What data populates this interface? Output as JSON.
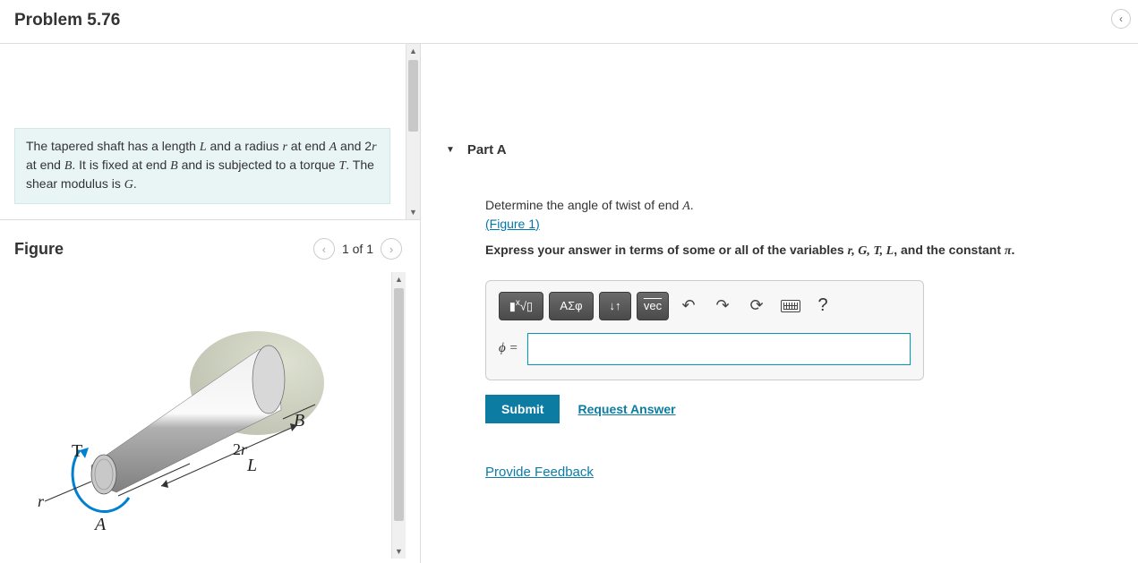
{
  "header": {
    "title": "Problem 5.76"
  },
  "problem": {
    "desc_prefix": "The tapered shaft has a length ",
    "var_L": "L",
    "desc_2": " and a radius ",
    "var_r": "r",
    "desc_3": " at end ",
    "var_A": "A",
    "desc_4": " and 2",
    "desc_5": " at end ",
    "var_B": "B",
    "desc_6": ". It is fixed at end ",
    "desc_7": " and is subjected to a torque ",
    "var_T": "T",
    "desc_8": ". The shear modulus is ",
    "var_G": "G",
    "desc_9": "."
  },
  "figure": {
    "title": "Figure",
    "count": "1 of 1",
    "labels": {
      "T": "T",
      "r": "r",
      "A": "A",
      "B": "B",
      "two_r": "2r",
      "L": "L"
    }
  },
  "part": {
    "label": "Part A",
    "instr1_prefix": "Determine the angle of twist of end ",
    "instr1_var": "A",
    "instr1_suffix": ".",
    "fig_link": "(Figure 1)",
    "instr2_prefix": "Express your answer in terms of some or all of the variables ",
    "vars": "r, G, T, L",
    "instr2_mid": ", and the constant ",
    "pi": "π",
    "instr2_suffix": "."
  },
  "toolbar": {
    "templates": "▮√▯",
    "greek": "ΑΣφ",
    "subscript": "↓↑",
    "vec": "vec",
    "help": "?"
  },
  "answer": {
    "label": "ϕ =",
    "value": ""
  },
  "actions": {
    "submit": "Submit",
    "request": "Request Answer"
  },
  "feedback": "Provide Feedback"
}
